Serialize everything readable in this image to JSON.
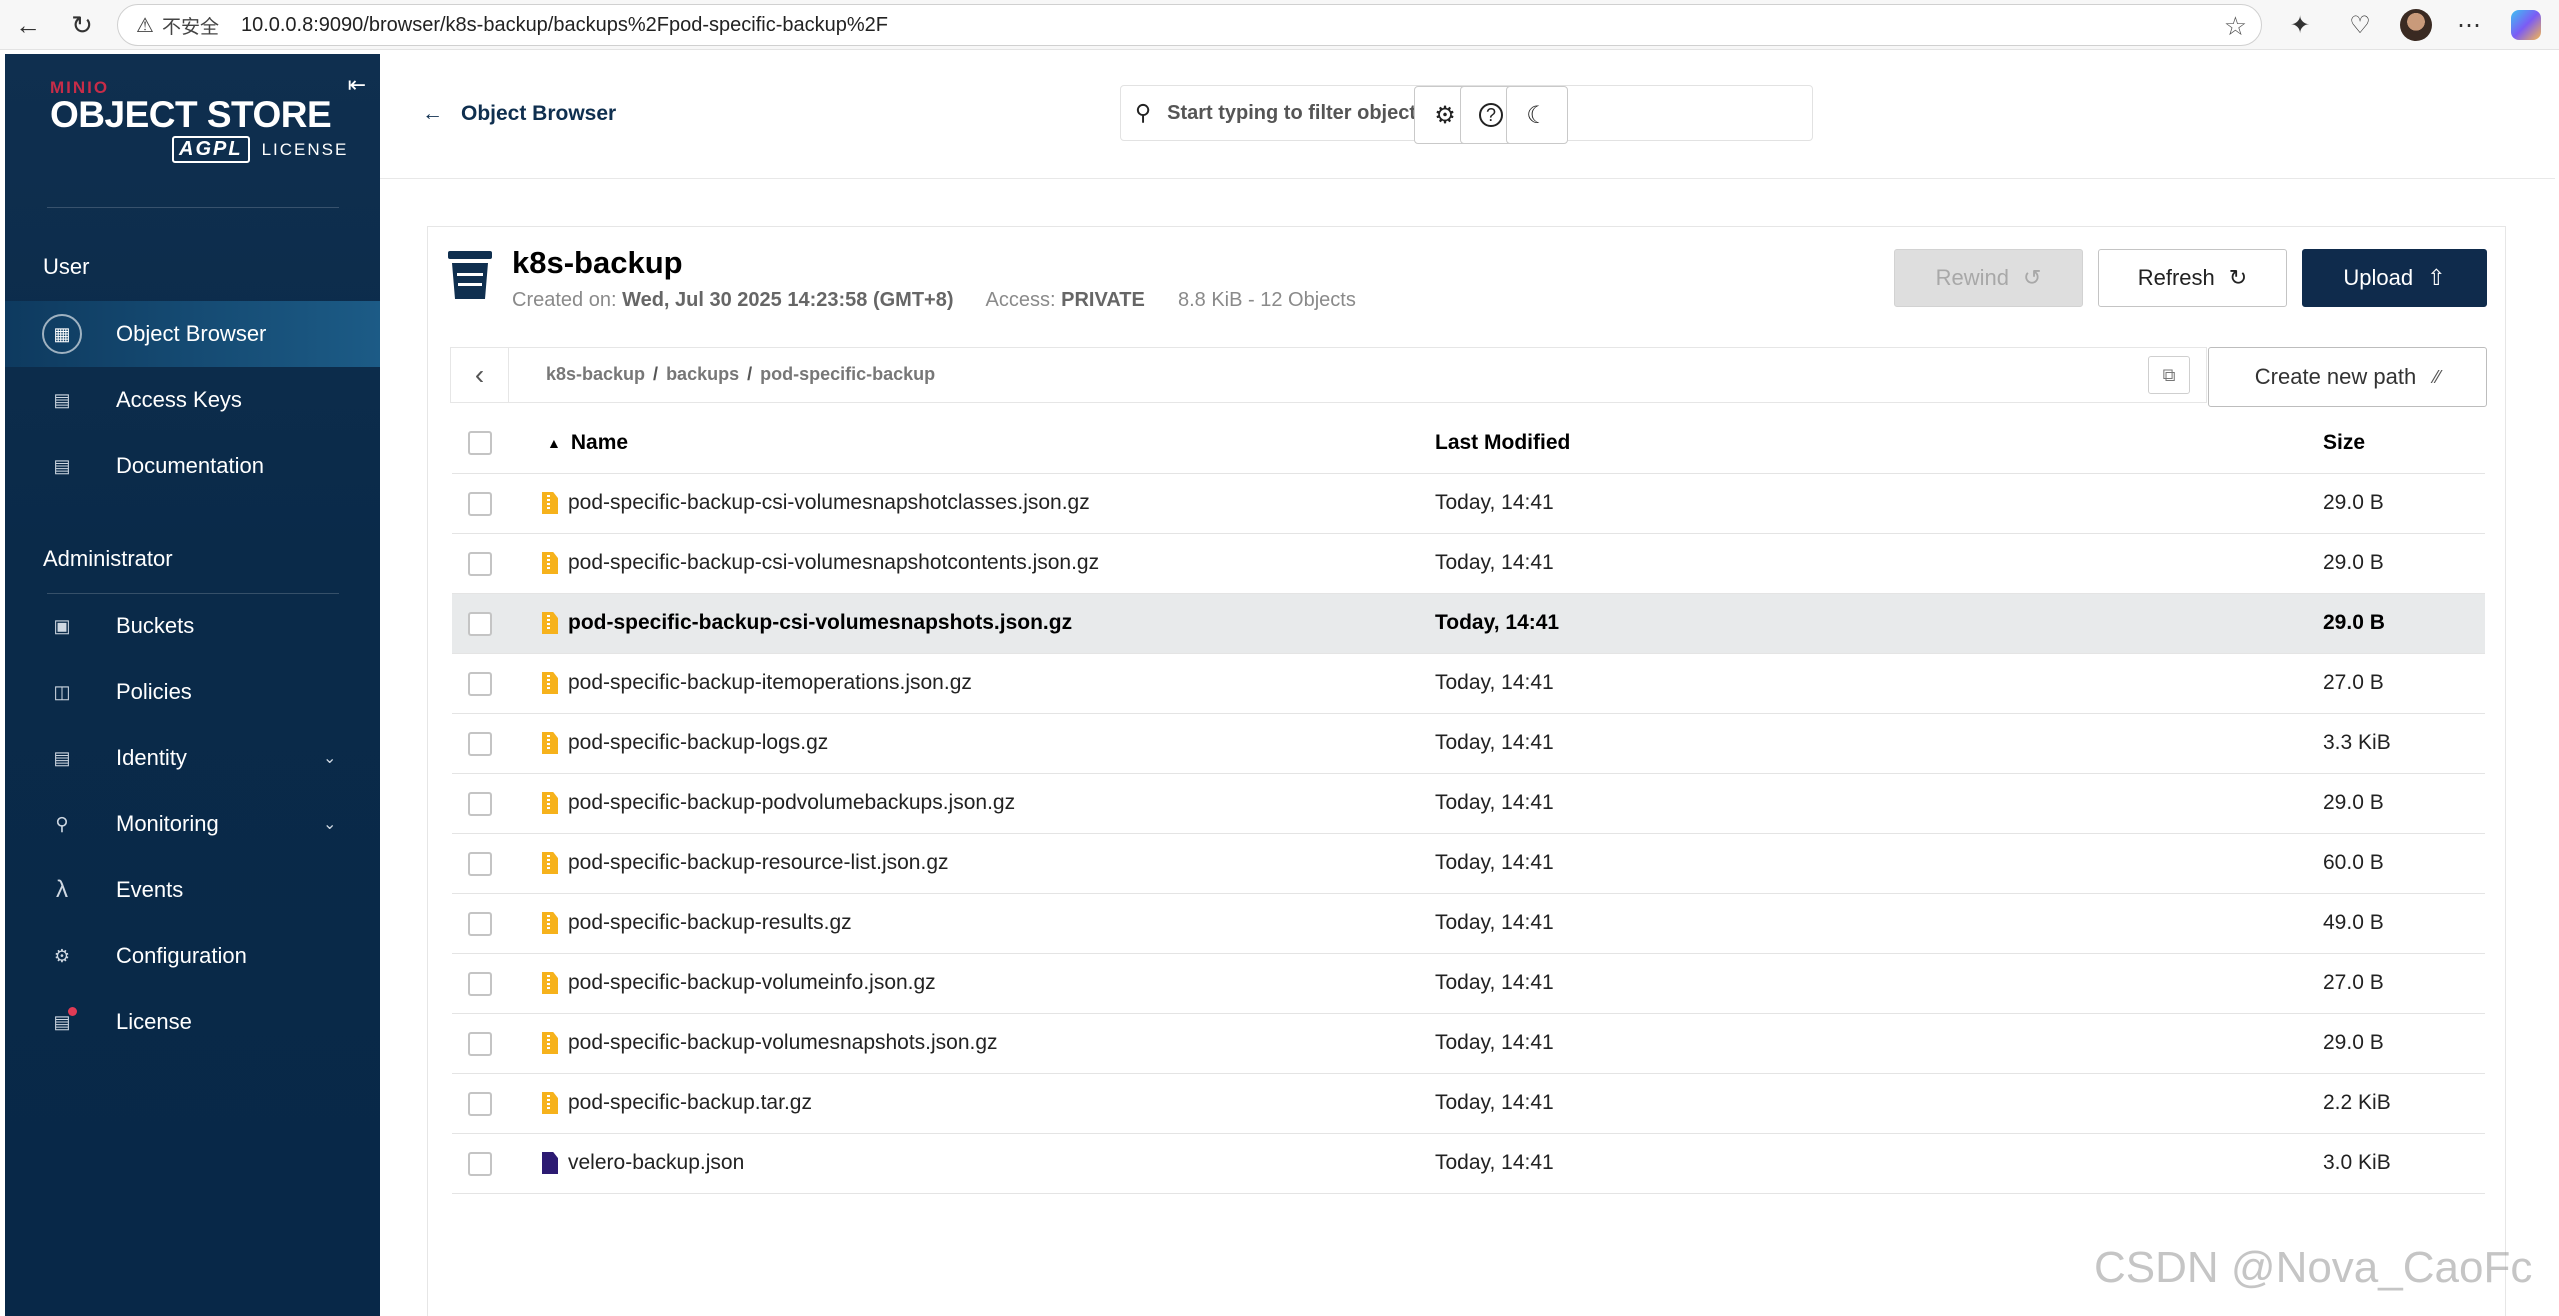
{
  "browser": {
    "security_label": "不安全",
    "url": "10.0.0.8:9090/browser/k8s-backup/backups%2Fpod-specific-backup%2F"
  },
  "sidebar": {
    "logo": {
      "brand": "MINIO",
      "product": "OBJECT STORE",
      "license_badge": "AGPL",
      "license_text": "LICENSE"
    },
    "sections": [
      {
        "title": "User",
        "items": [
          {
            "label": "Object Browser",
            "icon": "object-browser-icon",
            "active": true
          },
          {
            "label": "Access Keys",
            "icon": "access-keys-icon"
          },
          {
            "label": "Documentation",
            "icon": "documentation-icon"
          }
        ]
      },
      {
        "title": "Administrator",
        "items": [
          {
            "label": "Buckets",
            "icon": "buckets-icon"
          },
          {
            "label": "Policies",
            "icon": "policies-icon"
          },
          {
            "label": "Identity",
            "icon": "identity-icon",
            "expandable": true
          },
          {
            "label": "Monitoring",
            "icon": "monitoring-icon",
            "expandable": true
          },
          {
            "label": "Events",
            "icon": "lambda-icon"
          },
          {
            "label": "Configuration",
            "icon": "gear-icon"
          },
          {
            "label": "License",
            "icon": "license-icon",
            "badge": true
          }
        ]
      }
    ]
  },
  "header": {
    "back_label": "Object Browser",
    "search_placeholder": "Start typing to filter objects in the bucket"
  },
  "bucket": {
    "name": "k8s-backup",
    "created_label": "Created on:",
    "created_value": "Wed, Jul 30 2025 14:23:58 (GMT+8)",
    "access_label": "Access:",
    "access_value": "PRIVATE",
    "usage": "8.8 KiB - 12 Objects"
  },
  "actions": {
    "rewind": "Rewind",
    "refresh": "Refresh",
    "upload": "Upload",
    "create_path": "Create new path"
  },
  "breadcrumb": [
    "k8s-backup",
    "backups",
    "pod-specific-backup"
  ],
  "table": {
    "columns": {
      "name": "Name",
      "modified": "Last Modified",
      "size": "Size"
    },
    "rows": [
      {
        "name": "pod-specific-backup-csi-volumesnapshotclasses.json.gz",
        "modified": "Today, 14:41",
        "size": "29.0 B",
        "type": "gz"
      },
      {
        "name": "pod-specific-backup-csi-volumesnapshotcontents.json.gz",
        "modified": "Today, 14:41",
        "size": "29.0 B",
        "type": "gz"
      },
      {
        "name": "pod-specific-backup-csi-volumesnapshots.json.gz",
        "modified": "Today, 14:41",
        "size": "29.0 B",
        "type": "gz",
        "highlighted": true
      },
      {
        "name": "pod-specific-backup-itemoperations.json.gz",
        "modified": "Today, 14:41",
        "size": "27.0 B",
        "type": "gz"
      },
      {
        "name": "pod-specific-backup-logs.gz",
        "modified": "Today, 14:41",
        "size": "3.3 KiB",
        "type": "gz"
      },
      {
        "name": "pod-specific-backup-podvolumebackups.json.gz",
        "modified": "Today, 14:41",
        "size": "29.0 B",
        "type": "gz"
      },
      {
        "name": "pod-specific-backup-resource-list.json.gz",
        "modified": "Today, 14:41",
        "size": "60.0 B",
        "type": "gz"
      },
      {
        "name": "pod-specific-backup-results.gz",
        "modified": "Today, 14:41",
        "size": "49.0 B",
        "type": "gz"
      },
      {
        "name": "pod-specific-backup-volumeinfo.json.gz",
        "modified": "Today, 14:41",
        "size": "27.0 B",
        "type": "gz"
      },
      {
        "name": "pod-specific-backup-volumesnapshots.json.gz",
        "modified": "Today, 14:41",
        "size": "29.0 B",
        "type": "gz"
      },
      {
        "name": "pod-specific-backup.tar.gz",
        "modified": "Today, 14:41",
        "size": "2.2 KiB",
        "type": "gz"
      },
      {
        "name": "velero-backup.json",
        "modified": "Today, 14:41",
        "size": "3.0 KiB",
        "type": "json"
      }
    ]
  },
  "watermark": "CSDN @Nova_CaoFc"
}
